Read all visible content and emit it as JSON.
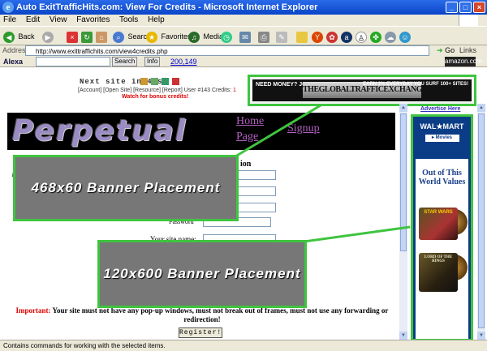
{
  "window": {
    "title": "Auto ExitTrafficHits.com: View For Credits - Microsoft Internet Explorer",
    "buttons": [
      "_",
      "□",
      "×"
    ]
  },
  "menubar": [
    "File",
    "Edit",
    "View",
    "Favorites",
    "Tools",
    "Help"
  ],
  "toolbar": {
    "back": "Back",
    "search": "Search",
    "favorites": "Favorites",
    "media": "Media"
  },
  "addressbar": {
    "label": "Address",
    "url": "http://www.exittraffichits.com/view4credits.php",
    "go": "Go",
    "links": "Links"
  },
  "alexabar": {
    "brand": "Alexa",
    "search": "Search",
    "info": "Info",
    "rank": "200,149",
    "amazon": "amazon.com"
  },
  "page": {
    "next_site": "Next site in 4 se",
    "account_line": "[Account] [Open Site] [Resource] [Report] User #143 Credits:",
    "credits": "1",
    "bonus": "Watch for bonus credits!",
    "site_logo": "Perpetual Hits",
    "links": [
      "Home",
      "Page",
      "Signup"
    ],
    "form_title": "ion",
    "password_label": "Password",
    "site_name_label": "Your site name:",
    "important_label": "Important:",
    "important_text": "Your site must not have any pop-up windows, must not break out of frames, must not use any forwarding or redirection!",
    "register_button": "Register!",
    "advertise": "Advertise Here"
  },
  "top_ad": {
    "left": "NEED MONEY? JOIN NOW!",
    "middle": "THEGLOBALTRAFFICEXCHANGE",
    "right": "EARN 2% EVERYDAY YOU SURF 100+ SITES!"
  },
  "side_ad": {
    "brand": "WAL★MART",
    "movies": "▸ Movies",
    "headline": "Out of This World Values",
    "dvd1": "STAR WARS",
    "dvd2": "LORD OF THE RINGS"
  },
  "placeholders": {
    "banner_468": "468x60 Banner Placement",
    "banner_120": "120x600 Banner Placement"
  },
  "statusbar": "Contains commands for working with the selected items.",
  "colors": {
    "highlight": "#3fc43f",
    "placeholder": "#777777",
    "title": "#0a44c8"
  }
}
